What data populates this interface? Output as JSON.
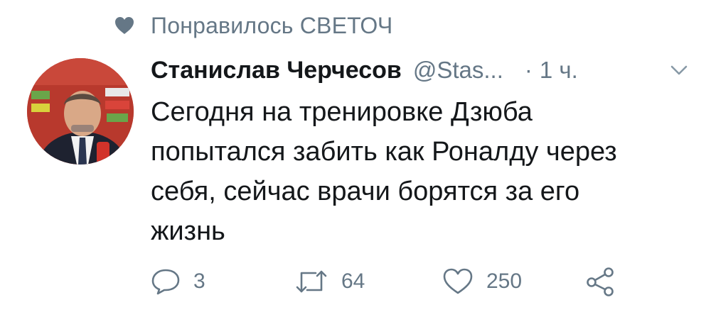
{
  "social_context": {
    "icon": "heart-icon",
    "text": "Понравилось СВЕТОЧ"
  },
  "tweet": {
    "avatar": "avatar-photo",
    "author": {
      "name": "Станислав Черчесов",
      "handle": "@Stas...",
      "separator": "·",
      "time": "1 ч."
    },
    "menu_icon": "chevron-down-icon",
    "text_lines": [
      "Сегодня на тренировке Дзюба",
      "попытался забить как Роналду через",
      "себя, сейчас врачи борятся за его",
      "жизнь"
    ],
    "actions": {
      "reply": {
        "icon": "reply-icon",
        "count": "3"
      },
      "retweet": {
        "icon": "retweet-icon",
        "count": "64"
      },
      "like": {
        "icon": "like-icon",
        "count": "250"
      },
      "share": {
        "icon": "share-icon"
      }
    }
  },
  "colors": {
    "text": "#14171a",
    "secondary": "#657786"
  }
}
